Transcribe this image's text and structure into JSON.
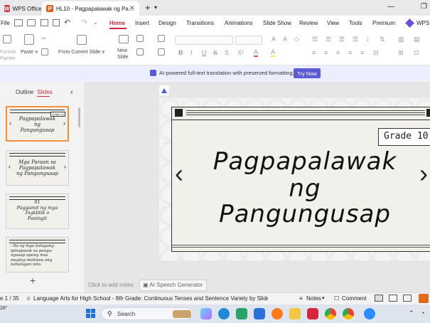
{
  "titlebar": {
    "tabs": [
      {
        "label": "WPS Office",
        "color": "#d6263b"
      },
      {
        "label": "HL10 - Pagpapalawak ng Pa…",
        "color": "#e65a1e"
      }
    ],
    "add_tab": "+",
    "tab_list": "▾",
    "window_controls": [
      "—",
      "❐"
    ]
  },
  "menu": {
    "file": "File",
    "items": [
      "Home",
      "Insert",
      "Design",
      "Transitions",
      "Animations",
      "Slide Show",
      "Review",
      "View",
      "Tools",
      "Premium",
      "WPS A"
    ]
  },
  "ribbon": {
    "format_painter": "Format\nPainter",
    "paste": "Paste",
    "from_current_slide": "From Current Slide",
    "new_slide": "New\nSlide"
  },
  "banner": {
    "text": "AI-powered full-text translation with preserved formatting.",
    "button": "Try Now",
    "accent": "#5b5bd6"
  },
  "left_panel": {
    "tab_outline": "Outline",
    "tab_slides": "Slides",
    "collapse": "‹",
    "add_slide": "+",
    "thumbnails": [
      {
        "text": "Pagpapalawak\nng\nPangungusap",
        "badge": "Grade 10"
      },
      {
        "text": "Mga Paraan sa\nPagpapalawak\nng Pangungusap"
      },
      {
        "text": "01\nPaggamit ng mga\nIngklitik o\nPaningit"
      },
      {
        "text": "- Ito ay mga katagang\nipinapasok sa pangu-\nngusap upang mas\nmaging malinaw ang\nkahulugan nito."
      }
    ]
  },
  "slide": {
    "badge": "Grade 10",
    "title_lines": [
      "Pagpapalawak",
      "ng",
      "Pangungusap"
    ],
    "prev": "‹",
    "next": "›"
  },
  "notes": {
    "placeholder": "Click to add notes",
    "speech": "AI Speech Generator"
  },
  "statusbar": {
    "slide_count": "e 1 / 35",
    "theme": "Language Arts for High School - 9th Grade: Continuous Tenses and Sentence Variety by Slidesgo",
    "notes": "Notes",
    "comment": "Comment"
  },
  "taskbar": {
    "temp": "28°",
    "search": "Search"
  }
}
